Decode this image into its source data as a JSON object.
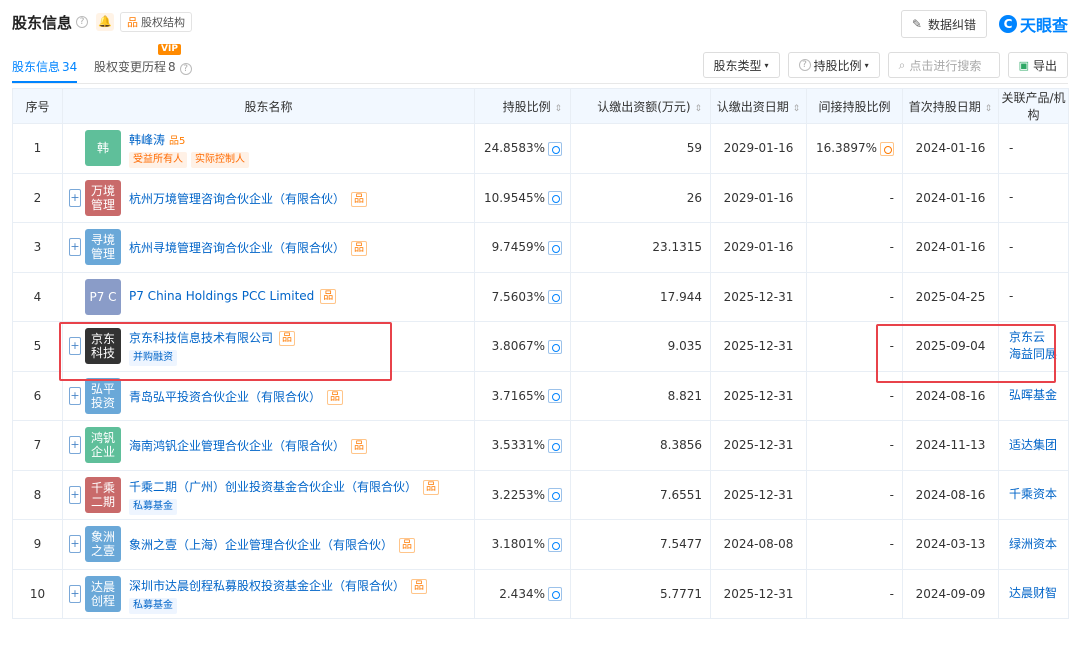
{
  "header": {
    "title": "股东信息",
    "struct_label": "股权结构",
    "fix_label": "数据纠错",
    "brand": "天眼查"
  },
  "tabs": [
    {
      "label": "股东信息",
      "count": "34"
    },
    {
      "label": "股权变更历程",
      "count": "8"
    }
  ],
  "vip": "VIP",
  "filters": {
    "type": "股东类型",
    "ratio": "持股比例",
    "search_placeholder": "点击进行搜索",
    "export": "导出"
  },
  "columns": [
    "序号",
    "股东名称",
    "持股比例",
    "认缴出资额(万元)",
    "认缴出资日期",
    "间接持股比例",
    "首次持股日期",
    "关联产品/机构"
  ],
  "rows": [
    {
      "idx": "1",
      "logo": "韩",
      "name": "韩峰涛",
      "hancount": "5",
      "tags": [
        "受益所有人",
        "实际控制人"
      ],
      "pct": "24.8583%",
      "amount": "59",
      "date": "2029-01-16",
      "indirect": "16.3897%",
      "first": "2024-01-16",
      "prod": [
        "-"
      ],
      "color": "#5fbf9a"
    },
    {
      "idx": "2",
      "logo": "万境 管理",
      "name": "杭州万境管理咨询合伙企业（有限合伙）",
      "tags": [],
      "pct": "10.9545%",
      "amount": "26",
      "date": "2029-01-16",
      "indirect": "-",
      "first": "2024-01-16",
      "prod": [
        "-"
      ],
      "color": "#c96a6a"
    },
    {
      "idx": "3",
      "logo": "寻境 管理",
      "name": "杭州寻境管理咨询合伙企业（有限合伙）",
      "tags": [],
      "pct": "9.7459%",
      "amount": "23.1315",
      "date": "2029-01-16",
      "indirect": "-",
      "first": "2024-01-16",
      "prod": [
        "-"
      ],
      "color": "#6aa8d8"
    },
    {
      "idx": "4",
      "logo": "P7 C",
      "name": "P7 China Holdings PCC Limited",
      "tags": [],
      "pct": "7.5603%",
      "amount": "17.944",
      "date": "2025-12-31",
      "indirect": "-",
      "first": "2025-04-25",
      "prod": [
        "-"
      ],
      "color": "#8a9cc8"
    },
    {
      "idx": "5",
      "logo": "京东科技",
      "name": "京东科技信息技术有限公司",
      "tags": [
        "并购融资"
      ],
      "pct": "3.8067%",
      "amount": "9.035",
      "date": "2025-12-31",
      "indirect": "-",
      "first": "2025-09-04",
      "prod": [
        "京东云",
        "海益同展"
      ],
      "color": "#333333"
    },
    {
      "idx": "6",
      "logo": "弘平 投资",
      "name": "青岛弘平投资合伙企业（有限合伙）",
      "tags": [],
      "pct": "3.7165%",
      "amount": "8.821",
      "date": "2025-12-31",
      "indirect": "-",
      "first": "2024-08-16",
      "prod": [
        "弘晖基金"
      ],
      "color": "#6aa8d8"
    },
    {
      "idx": "7",
      "logo": "鸿钒 企业",
      "name": "海南鸿钒企业管理合伙企业（有限合伙）",
      "tags": [],
      "pct": "3.5331%",
      "amount": "8.3856",
      "date": "2025-12-31",
      "indirect": "-",
      "first": "2024-11-13",
      "prod": [
        "适达集团"
      ],
      "color": "#5fbf9a"
    },
    {
      "idx": "8",
      "logo": "千乘 二期",
      "name": "千乘二期（广州）创业投资基金合伙企业（有限合伙）",
      "tags": [
        "私募基金"
      ],
      "pct": "3.2253%",
      "amount": "7.6551",
      "date": "2025-12-31",
      "indirect": "-",
      "first": "2024-08-16",
      "prod": [
        "千乘资本"
      ],
      "color": "#c96a6a"
    },
    {
      "idx": "9",
      "logo": "象洲 之壹",
      "name": "象洲之壹（上海）企业管理合伙企业（有限合伙）",
      "tags": [],
      "pct": "3.1801%",
      "amount": "7.5477",
      "date": "2024-08-08",
      "indirect": "-",
      "first": "2024-03-13",
      "prod": [
        "绿洲资本"
      ],
      "color": "#6aa8d8"
    },
    {
      "idx": "10",
      "logo": "达晨 创程",
      "name": "深圳市达晨创程私募股权投资基金企业（有限合伙）",
      "tags": [
        "私募基金"
      ],
      "pct": "2.434%",
      "amount": "5.7771",
      "date": "2025-12-31",
      "indirect": "-",
      "first": "2024-09-09",
      "prod": [
        "达晨财智"
      ],
      "color": "#6aa8d8"
    }
  ]
}
